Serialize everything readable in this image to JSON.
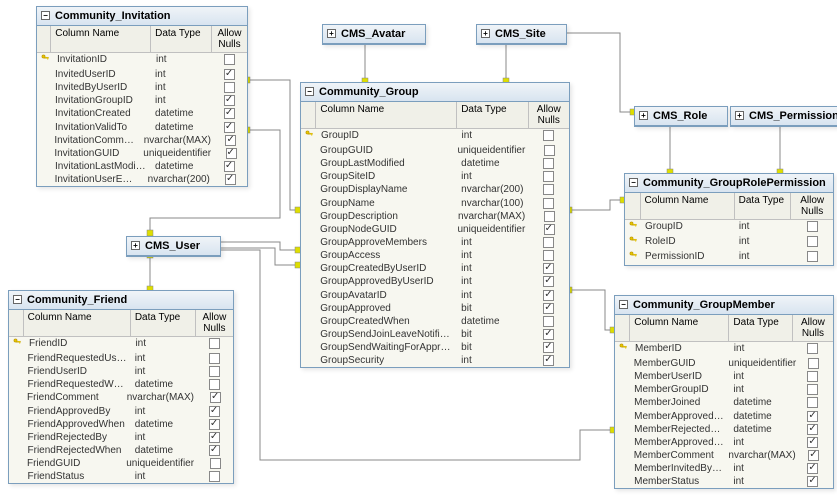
{
  "headers": {
    "name": "Column Name",
    "type": "Data Type",
    "nulls": "Allow Nulls"
  },
  "tables": {
    "invitation": {
      "title": "Community_Invitation",
      "rows": [
        {
          "pk": true,
          "name": "InvitationID",
          "type": "int",
          "null": false
        },
        {
          "pk": false,
          "name": "InvitedUserID",
          "type": "int",
          "null": true
        },
        {
          "pk": false,
          "name": "InvitedByUserID",
          "type": "int",
          "null": false
        },
        {
          "pk": false,
          "name": "InvitationGroupID",
          "type": "int",
          "null": true
        },
        {
          "pk": false,
          "name": "InvitationCreated",
          "type": "datetime",
          "null": true
        },
        {
          "pk": false,
          "name": "InvitationValidTo",
          "type": "datetime",
          "null": true
        },
        {
          "pk": false,
          "name": "InvitationComment",
          "type": "nvarchar(MAX)",
          "null": true
        },
        {
          "pk": false,
          "name": "InvitationGUID",
          "type": "uniqueidentifier",
          "null": true
        },
        {
          "pk": false,
          "name": "InvitationLastModified",
          "type": "datetime",
          "null": true
        },
        {
          "pk": false,
          "name": "InvitationUserEmail",
          "type": "nvarchar(200)",
          "null": true
        }
      ]
    },
    "group": {
      "title": "Community_Group",
      "rows": [
        {
          "pk": true,
          "name": "GroupID",
          "type": "int",
          "null": false
        },
        {
          "pk": false,
          "name": "GroupGUID",
          "type": "uniqueidentifier",
          "null": false
        },
        {
          "pk": false,
          "name": "GroupLastModified",
          "type": "datetime",
          "null": false
        },
        {
          "pk": false,
          "name": "GroupSiteID",
          "type": "int",
          "null": false
        },
        {
          "pk": false,
          "name": "GroupDisplayName",
          "type": "nvarchar(200)",
          "null": false
        },
        {
          "pk": false,
          "name": "GroupName",
          "type": "nvarchar(100)",
          "null": false
        },
        {
          "pk": false,
          "name": "GroupDescription",
          "type": "nvarchar(MAX)",
          "null": false
        },
        {
          "pk": false,
          "name": "GroupNodeGUID",
          "type": "uniqueidentifier",
          "null": true
        },
        {
          "pk": false,
          "name": "GroupApproveMembers",
          "type": "int",
          "null": false
        },
        {
          "pk": false,
          "name": "GroupAccess",
          "type": "int",
          "null": false
        },
        {
          "pk": false,
          "name": "GroupCreatedByUserID",
          "type": "int",
          "null": true
        },
        {
          "pk": false,
          "name": "GroupApprovedByUserID",
          "type": "int",
          "null": true
        },
        {
          "pk": false,
          "name": "GroupAvatarID",
          "type": "int",
          "null": true
        },
        {
          "pk": false,
          "name": "GroupApproved",
          "type": "bit",
          "null": true
        },
        {
          "pk": false,
          "name": "GroupCreatedWhen",
          "type": "datetime",
          "null": false
        },
        {
          "pk": false,
          "name": "GroupSendJoinLeaveNotification",
          "type": "bit",
          "null": true
        },
        {
          "pk": false,
          "name": "GroupSendWaitingForApprovalNotification",
          "type": "bit",
          "null": true
        },
        {
          "pk": false,
          "name": "GroupSecurity",
          "type": "int",
          "null": true
        }
      ]
    },
    "friend": {
      "title": "Community_Friend",
      "rows": [
        {
          "pk": true,
          "name": "FriendID",
          "type": "int",
          "null": false
        },
        {
          "pk": false,
          "name": "FriendRequestedUserID",
          "type": "int",
          "null": false
        },
        {
          "pk": false,
          "name": "FriendUserID",
          "type": "int",
          "null": false
        },
        {
          "pk": false,
          "name": "FriendRequestedWhen",
          "type": "datetime",
          "null": false
        },
        {
          "pk": false,
          "name": "FriendComment",
          "type": "nvarchar(MAX)",
          "null": true
        },
        {
          "pk": false,
          "name": "FriendApprovedBy",
          "type": "int",
          "null": true
        },
        {
          "pk": false,
          "name": "FriendApprovedWhen",
          "type": "datetime",
          "null": true
        },
        {
          "pk": false,
          "name": "FriendRejectedBy",
          "type": "int",
          "null": true
        },
        {
          "pk": false,
          "name": "FriendRejectedWhen",
          "type": "datetime",
          "null": true
        },
        {
          "pk": false,
          "name": "FriendGUID",
          "type": "uniqueidentifier",
          "null": false
        },
        {
          "pk": false,
          "name": "FriendStatus",
          "type": "int",
          "null": false
        }
      ]
    },
    "groupRolePerm": {
      "title": "Community_GroupRolePermission",
      "rows": [
        {
          "pk": true,
          "name": "GroupID",
          "type": "int",
          "null": false
        },
        {
          "pk": true,
          "name": "RoleID",
          "type": "int",
          "null": false
        },
        {
          "pk": true,
          "name": "PermissionID",
          "type": "int",
          "null": false
        }
      ]
    },
    "groupMember": {
      "title": "Community_GroupMember",
      "rows": [
        {
          "pk": true,
          "name": "MemberID",
          "type": "int",
          "null": false
        },
        {
          "pk": false,
          "name": "MemberGUID",
          "type": "uniqueidentifier",
          "null": false
        },
        {
          "pk": false,
          "name": "MemberUserID",
          "type": "int",
          "null": false
        },
        {
          "pk": false,
          "name": "MemberGroupID",
          "type": "int",
          "null": false
        },
        {
          "pk": false,
          "name": "MemberJoined",
          "type": "datetime",
          "null": false
        },
        {
          "pk": false,
          "name": "MemberApprovedWhen",
          "type": "datetime",
          "null": true
        },
        {
          "pk": false,
          "name": "MemberRejectedWhen",
          "type": "datetime",
          "null": true
        },
        {
          "pk": false,
          "name": "MemberApprovedByU...",
          "type": "int",
          "null": true
        },
        {
          "pk": false,
          "name": "MemberComment",
          "type": "nvarchar(MAX)",
          "null": true
        },
        {
          "pk": false,
          "name": "MemberInvitedByUserID",
          "type": "int",
          "null": true
        },
        {
          "pk": false,
          "name": "MemberStatus",
          "type": "int",
          "null": true
        }
      ]
    }
  },
  "mini": {
    "avatar": "CMS_Avatar",
    "site": "CMS_Site",
    "role": "CMS_Role",
    "permission": "CMS_Permission",
    "user": "CMS_User"
  }
}
